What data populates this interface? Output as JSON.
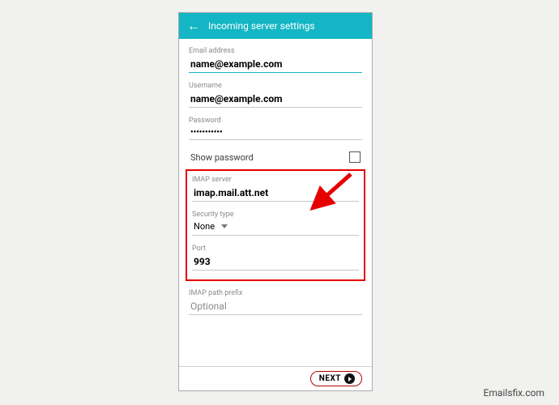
{
  "header": {
    "title": "Incoming server settings"
  },
  "fields": {
    "email": {
      "label": "Email address",
      "value": "name@example.com"
    },
    "username": {
      "label": "Username",
      "value": "name@example.com"
    },
    "password": {
      "label": "Password",
      "value": "•••••••••••"
    },
    "show_password": "Show password",
    "imap_server": {
      "label": "IMAP server",
      "value": "imap.mail.att.net"
    },
    "security": {
      "label": "Security type",
      "value": "None"
    },
    "port": {
      "label": "Port",
      "value": "993"
    },
    "imap_prefix": {
      "label": "IMAP path prefix",
      "placeholder": "Optional"
    }
  },
  "buttons": {
    "next": "NEXT"
  },
  "watermark": "Emailsfix.com"
}
